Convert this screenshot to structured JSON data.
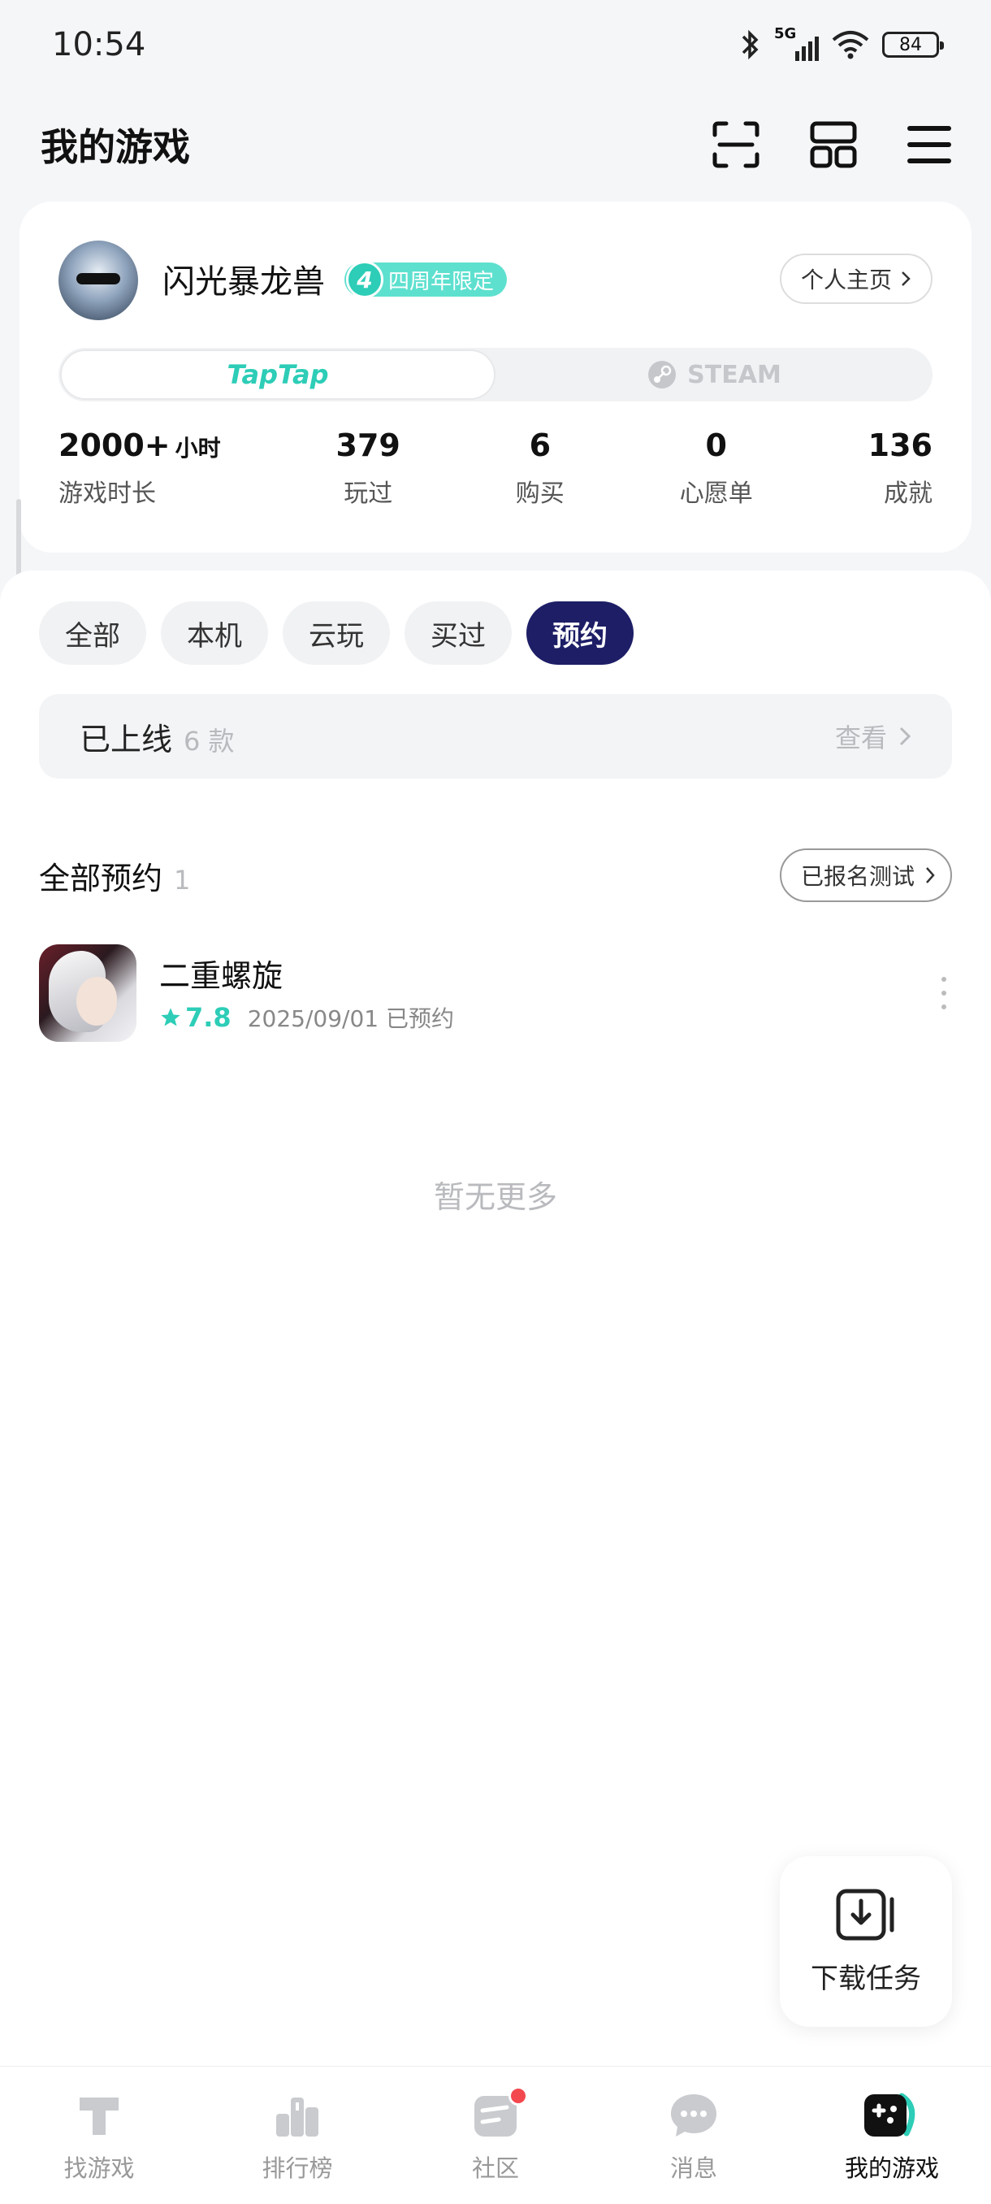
{
  "status_bar": {
    "time": "10:54",
    "network": "5G",
    "battery": "84"
  },
  "header": {
    "title": "我的游戏"
  },
  "profile": {
    "username": "闪光暴龙兽",
    "badge_number": "4",
    "badge_text": "四周年限定",
    "home_link": "个人主页",
    "platforms": {
      "taptap": "TapTap",
      "steam": "STEAM"
    },
    "stats": [
      {
        "value": "2000+",
        "unit": "小时",
        "label": "游戏时长"
      },
      {
        "value": "379",
        "label": "玩过"
      },
      {
        "value": "6",
        "label": "购买"
      },
      {
        "value": "0",
        "label": "心愿单"
      },
      {
        "value": "136",
        "label": "成就"
      }
    ]
  },
  "filters": [
    {
      "label": "全部",
      "active": false
    },
    {
      "label": "本机",
      "active": false
    },
    {
      "label": "云玩",
      "active": false
    },
    {
      "label": "买过",
      "active": false
    },
    {
      "label": "预约",
      "active": true
    }
  ],
  "online_bar": {
    "title": "已上线",
    "count": "6 款",
    "view": "查看"
  },
  "section": {
    "title": "全部预约",
    "count": "1",
    "test_button": "已报名测试"
  },
  "games": [
    {
      "name": "二重螺旋",
      "rating": "7.8",
      "meta": "2025/09/01 已预约"
    }
  ],
  "no_more": "暂无更多",
  "download_task": {
    "label": "下载任务"
  },
  "tabs": [
    {
      "label": "找游戏",
      "icon": "find-games-icon"
    },
    {
      "label": "排行榜",
      "icon": "ranking-icon"
    },
    {
      "label": "社区",
      "icon": "community-icon"
    },
    {
      "label": "消息",
      "icon": "message-icon"
    },
    {
      "label": "我的游戏",
      "icon": "my-games-icon"
    }
  ],
  "colors": {
    "accent": "#2dcdb7",
    "active_chip": "#1d1e66",
    "notification": "#f2484e"
  }
}
